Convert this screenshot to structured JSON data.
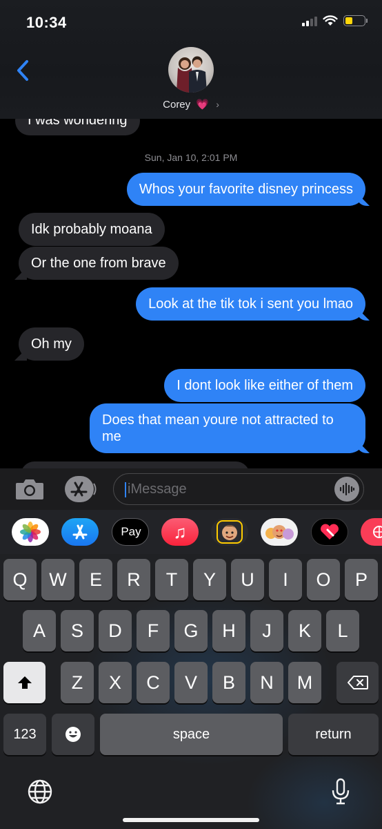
{
  "status_bar": {
    "time": "10:34"
  },
  "header": {
    "contact_name": "Corey",
    "heart": "💗",
    "chevron": "›"
  },
  "thread": {
    "partial_top_message": "I was wondering",
    "timestamp": "Sun, Jan 10, 2:01 PM",
    "messages": [
      {
        "direction": "out",
        "text": "Whos your favorite disney princess"
      },
      {
        "direction": "in",
        "text": "Idk probably moana"
      },
      {
        "direction": "in",
        "text": "Or the one from brave"
      },
      {
        "direction": "out",
        "text": "Look at the tik tok i sent you lmao"
      },
      {
        "direction": "in",
        "text": "Oh my"
      },
      {
        "direction": "out",
        "text": "I dont look like either of them"
      },
      {
        "direction": "out",
        "text": "Does that mean youre not attracted to me"
      }
    ]
  },
  "input": {
    "placeholder": "iMessage"
  },
  "app_drawer": {
    "apps": [
      "photos-app",
      "app-store-app",
      "apple-pay-app",
      "music-app",
      "memoji-app",
      "animoji-app",
      "digital-touch-app",
      "web-images-app"
    ],
    "apple_pay_label": "Pay"
  },
  "keyboard": {
    "row1": [
      "Q",
      "W",
      "E",
      "R",
      "T",
      "Y",
      "U",
      "I",
      "O",
      "P"
    ],
    "row2": [
      "A",
      "S",
      "D",
      "F",
      "G",
      "H",
      "J",
      "K",
      "L"
    ],
    "row3": [
      "Z",
      "X",
      "C",
      "V",
      "B",
      "N",
      "M"
    ],
    "numbers_label": "123",
    "space_label": "space",
    "return_label": "return"
  }
}
